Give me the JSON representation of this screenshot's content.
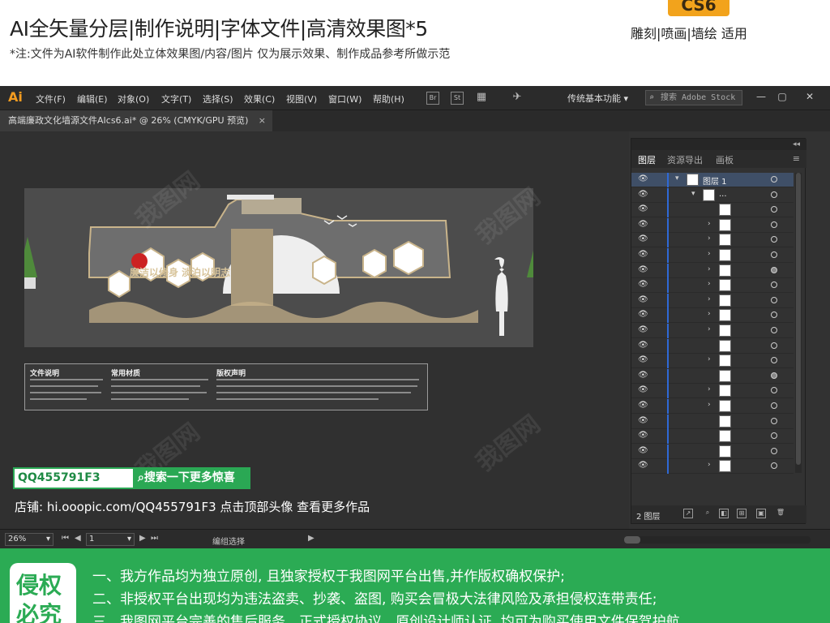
{
  "banner": {
    "title": "AI全矢量分层|制作说明|字体文件|高清效果图*5",
    "note": "*注:文件为AI软件制作此处立体效果图/内容/图片 仅为展示效果、制作成品参考所做示范",
    "cs6_label": "CS6",
    "usage": "雕刻|喷画|墙绘 适用"
  },
  "app": {
    "logo": "Ai",
    "menu": [
      "文件(F)",
      "编辑(E)",
      "对象(O)",
      "文字(T)",
      "选择(S)",
      "效果(C)",
      "视图(V)",
      "窗口(W)",
      "帮助(H)"
    ],
    "mini_icons": [
      "Br",
      "St"
    ],
    "workspace": "传统基本功能",
    "search_placeholder": "搜索 Adobe Stock",
    "doc_tab": "高端廉政文化墙源文件AIcs6.ai* @ 26% (CMYK/GPU 预览)",
    "doc_tab_close": "×"
  },
  "artboard": {
    "wall_title": "廉洁以修身 淡泊以明志",
    "info_sections": [
      "文件说明",
      "常用材质",
      "版权声明"
    ]
  },
  "promo": {
    "qq": "QQ455791F3",
    "search_btn": "搜索一下更多惊喜",
    "shop": "店铺: hi.ooopic.com/QQ455791F3  点击顶部头像 查看更多作品"
  },
  "status": {
    "zoom": "26%",
    "page": "1",
    "mode": "编组选择"
  },
  "layers_panel": {
    "collapse": "◂◂",
    "tabs": [
      "图层",
      "资源导出",
      "画板"
    ],
    "layer_name": "图层 1",
    "sublayer_name": "...",
    "layer_count": "2 图层",
    "rows": [
      {
        "indent": 0,
        "expanded": true,
        "name": "图层 1",
        "selected": true,
        "filled": false
      },
      {
        "indent": 1,
        "expanded": true,
        "name": "...",
        "selected": false,
        "filled": false
      },
      {
        "indent": 2,
        "expanded": null,
        "name": "",
        "selected": false,
        "filled": false
      },
      {
        "indent": 2,
        "expanded": false,
        "name": "",
        "selected": false,
        "filled": false
      },
      {
        "indent": 2,
        "expanded": false,
        "name": "",
        "selected": false,
        "filled": false
      },
      {
        "indent": 2,
        "expanded": false,
        "name": "",
        "selected": false,
        "filled": false
      },
      {
        "indent": 2,
        "expanded": false,
        "name": "",
        "selected": false,
        "filled": true
      },
      {
        "indent": 2,
        "expanded": false,
        "name": "",
        "selected": false,
        "filled": false
      },
      {
        "indent": 2,
        "expanded": false,
        "name": "",
        "selected": false,
        "filled": false
      },
      {
        "indent": 2,
        "expanded": false,
        "name": "",
        "selected": false,
        "filled": false
      },
      {
        "indent": 2,
        "expanded": false,
        "name": "",
        "selected": false,
        "filled": false
      },
      {
        "indent": 2,
        "expanded": null,
        "name": "",
        "selected": false,
        "filled": false
      },
      {
        "indent": 2,
        "expanded": false,
        "name": "",
        "selected": false,
        "filled": false
      },
      {
        "indent": 2,
        "expanded": null,
        "name": "",
        "selected": false,
        "filled": true
      },
      {
        "indent": 2,
        "expanded": false,
        "name": "",
        "selected": false,
        "filled": false
      },
      {
        "indent": 2,
        "expanded": false,
        "name": "",
        "selected": false,
        "filled": false
      },
      {
        "indent": 2,
        "expanded": null,
        "name": "",
        "selected": false,
        "filled": false
      },
      {
        "indent": 2,
        "expanded": null,
        "name": "",
        "selected": false,
        "filled": false
      },
      {
        "indent": 2,
        "expanded": null,
        "name": "",
        "selected": false,
        "filled": false
      },
      {
        "indent": 2,
        "expanded": false,
        "name": "",
        "selected": false,
        "filled": false
      },
      {
        "indent": 1,
        "expanded": false,
        "name": "...",
        "selected": false,
        "filled": false
      },
      {
        "indent": 1,
        "expanded": false,
        "name": "...",
        "selected": false,
        "filled": false
      }
    ]
  },
  "footer": {
    "card": [
      "侵权",
      "必究"
    ],
    "lines": [
      "一、我方作品均为独立原创, 且独家授权于我图网平台出售,并作版权确权保护;",
      "二、非授权平台出现均为违法盗卖、抄袭、盗图, 购买会冒极大法律风险及承担侵权连带责任;",
      "三、我图网平台完善的售后服务、正式授权协议、原创设计师认证, 均可为购买使用文件保驾护航。"
    ]
  },
  "colors": {
    "accent_green": "#2bab54",
    "ai_orange": "#f49c20",
    "layer_blue": "#2f69d6",
    "wall_gold": "#d8c49b"
  }
}
